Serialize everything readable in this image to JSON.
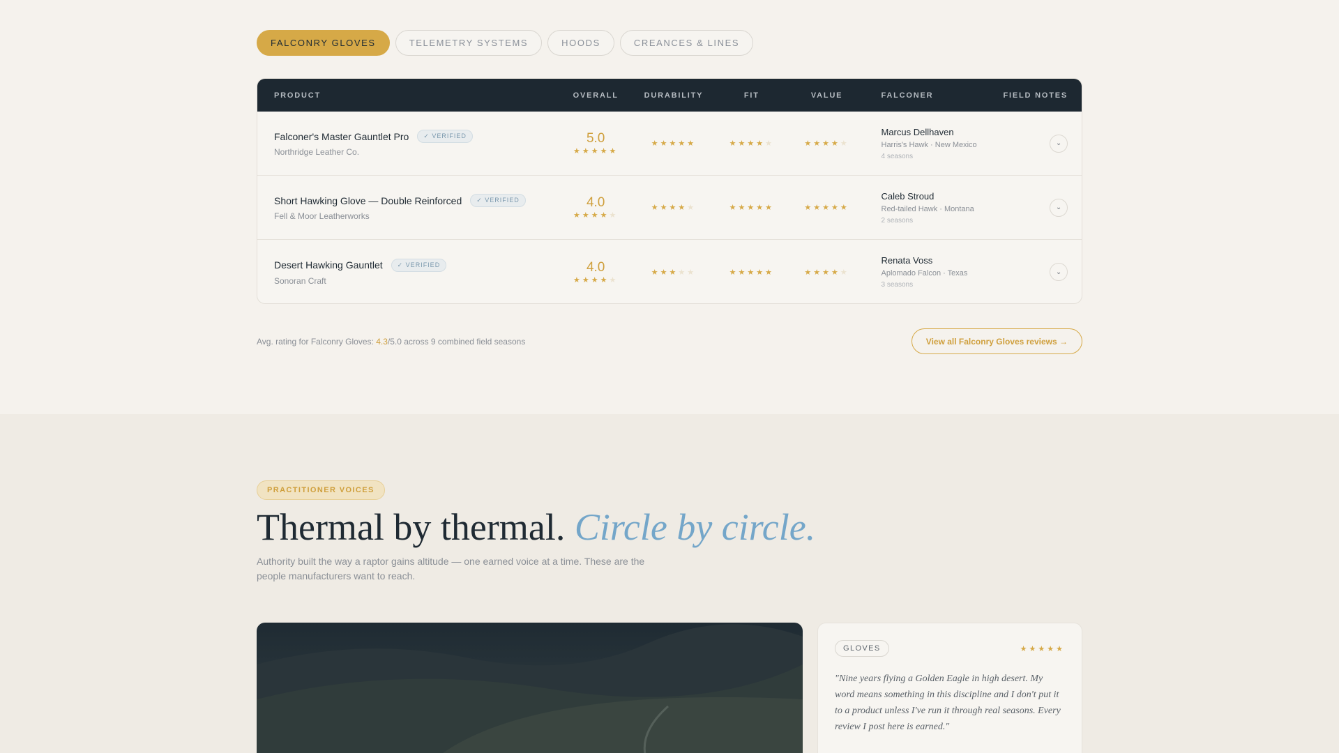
{
  "tabs": [
    {
      "label": "FALCONRY GLOVES",
      "active": true
    },
    {
      "label": "TELEMETRY SYSTEMS",
      "active": false
    },
    {
      "label": "HOODS",
      "active": false
    },
    {
      "label": "CREANCES & LINES",
      "active": false
    }
  ],
  "table": {
    "headers": {
      "product": "PRODUCT",
      "overall": "OVERALL",
      "durability": "DURABILITY",
      "fit": "FIT",
      "value": "VALUE",
      "falconer": "FALCONER",
      "notes": "FIELD NOTES"
    },
    "verified_label": "✓ VERIFIED",
    "rows": [
      {
        "product": "Falconer's Master Gauntlet Pro",
        "maker": "Northridge Leather Co.",
        "overall": "5.0",
        "overall_stars": 5,
        "durability": 5,
        "fit": 4,
        "value": 4,
        "falconer": "Marcus Dellhaven",
        "bird": "Harris's Hawk · New Mexico",
        "seasons": "4 seasons"
      },
      {
        "product": "Short Hawking Glove — Double Reinforced",
        "maker": "Fell & Moor Leatherworks",
        "overall": "4.0",
        "overall_stars": 4,
        "durability": 4,
        "fit": 5,
        "value": 5,
        "falconer": "Caleb Stroud",
        "bird": "Red-tailed Hawk · Montana",
        "seasons": "2 seasons"
      },
      {
        "product": "Desert Hawking Gauntlet",
        "maker": "Sonoran Craft",
        "overall": "4.0",
        "overall_stars": 4,
        "durability": 3,
        "fit": 5,
        "value": 4,
        "falconer": "Renata Voss",
        "bird": "Aplomado Falcon · Texas",
        "seasons": "3 seasons"
      }
    ]
  },
  "summary": {
    "prefix": "Avg. rating for Falconry Gloves: ",
    "avg": "4.3",
    "suffix": "/5.0 across 9 combined field seasons",
    "view_all": "View all Falconry Gloves reviews →"
  },
  "voices": {
    "eyebrow": "PRACTITIONER VOICES",
    "headline": "Thermal by thermal. ",
    "headline_em": "Circle by circle.",
    "lede": "Authority built the way a raptor gains altitude — one earned voice at a time. These are the people manufacturers want to reach."
  },
  "review_card": {
    "category": "GLOVES",
    "stars": 5,
    "quote": "\"Nine years flying a Golden Eagle in high desert. My word means something in this discipline and I don't put it to a product unless I've run it through real seasons. Every review I post here is earned.\""
  },
  "colors": {
    "gold": "#d6a947",
    "navy": "#1d2831",
    "accent_blue": "#74a6c9"
  }
}
